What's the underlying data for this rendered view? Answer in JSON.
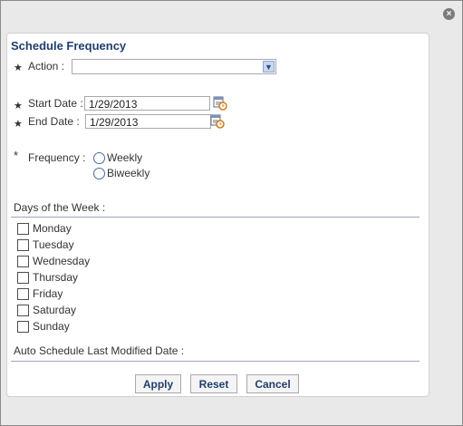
{
  "dialog": {
    "title": "Schedule Frequency",
    "required_mark": "★",
    "close_glyph": "×"
  },
  "form": {
    "action_label": "Action :",
    "action_value": "",
    "start_date_label": "Start Date :",
    "start_date_value": "1/29/2013",
    "end_date_label": "End Date :",
    "end_date_value": "1/29/2013",
    "frequency_label": "Frequency :",
    "frequency_options": [
      "Weekly",
      "Biweekly"
    ],
    "days_label": "Days of the Week :",
    "days": [
      "Monday",
      "Tuesday",
      "Wednesday",
      "Thursday",
      "Friday",
      "Saturday",
      "Sunday"
    ],
    "auto_schedule_label": "Auto Schedule Last Modified Date :"
  },
  "buttons": {
    "apply": "Apply",
    "reset": "Reset",
    "cancel": "Cancel"
  },
  "colors": {
    "title": "#1f3f6d",
    "panel": "#ffffff",
    "dialog_bg": "#e9e9e9"
  },
  "icons": {
    "close": "close-icon",
    "calendar": "calendar-clock-icon",
    "dropdown": "chevron-down-icon"
  }
}
